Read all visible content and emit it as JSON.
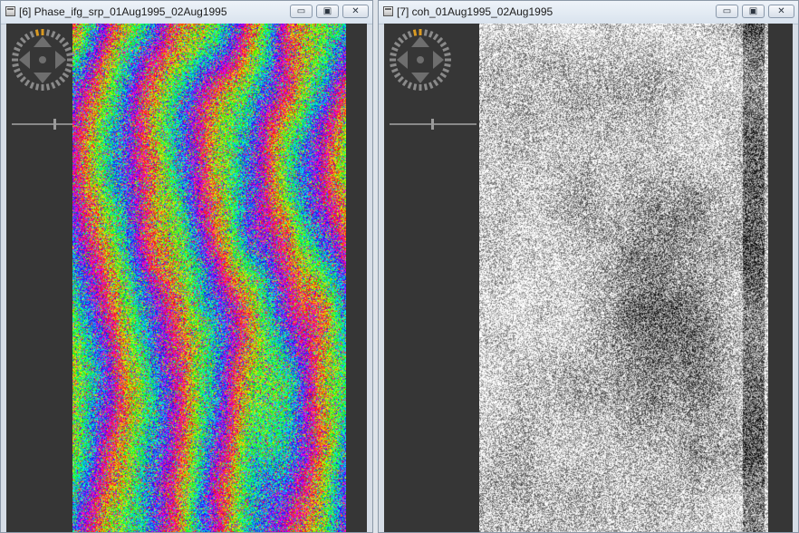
{
  "windows": [
    {
      "title": "[6] Phase_ifg_srp_01Aug1995_02Aug1995",
      "buttons": {
        "minimize": "▭",
        "restore": "▣",
        "close": "✕"
      },
      "image_kind": "phase",
      "icons": [
        "navigation-compass-icon",
        "zoom-slider"
      ]
    },
    {
      "title": "[7] coh_01Aug1995_02Aug1995",
      "buttons": {
        "minimize": "▭",
        "restore": "▣",
        "close": "✕"
      },
      "image_kind": "coherence",
      "icons": [
        "navigation-compass-icon",
        "zoom-slider"
      ]
    }
  ],
  "colors": {
    "background": "#363636",
    "compass_accent": "#d99a22",
    "compass_ring": "#8a8a8a"
  }
}
